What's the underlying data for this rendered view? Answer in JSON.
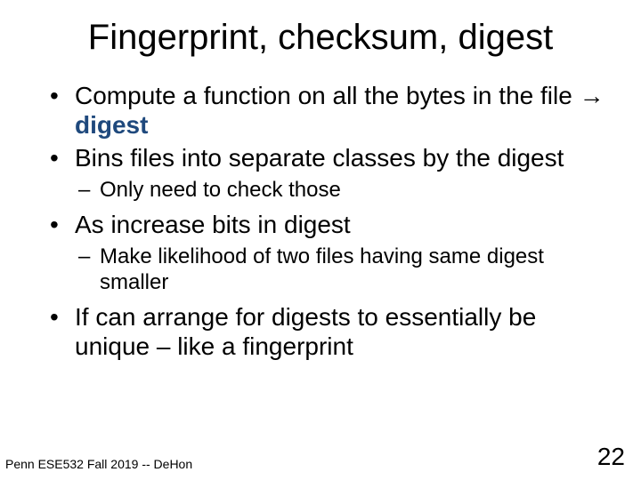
{
  "title": "Fingerprint, checksum, digest",
  "bullets": {
    "b1_pre": "Compute a function on all the bytes in the file ",
    "b1_arrow": "→",
    "b1_digest": " digest",
    "b2": "Bins files into separate classes by the digest",
    "b2_sub1": "Only need to check those",
    "b3": "As increase bits in digest",
    "b3_sub1": "Make likelihood of two files having same digest smaller",
    "b4": "If can arrange for digests to essentially be unique – like a fingerprint"
  },
  "footer": "Penn ESE532 Fall 2019 -- DeHon",
  "page_number": "22"
}
